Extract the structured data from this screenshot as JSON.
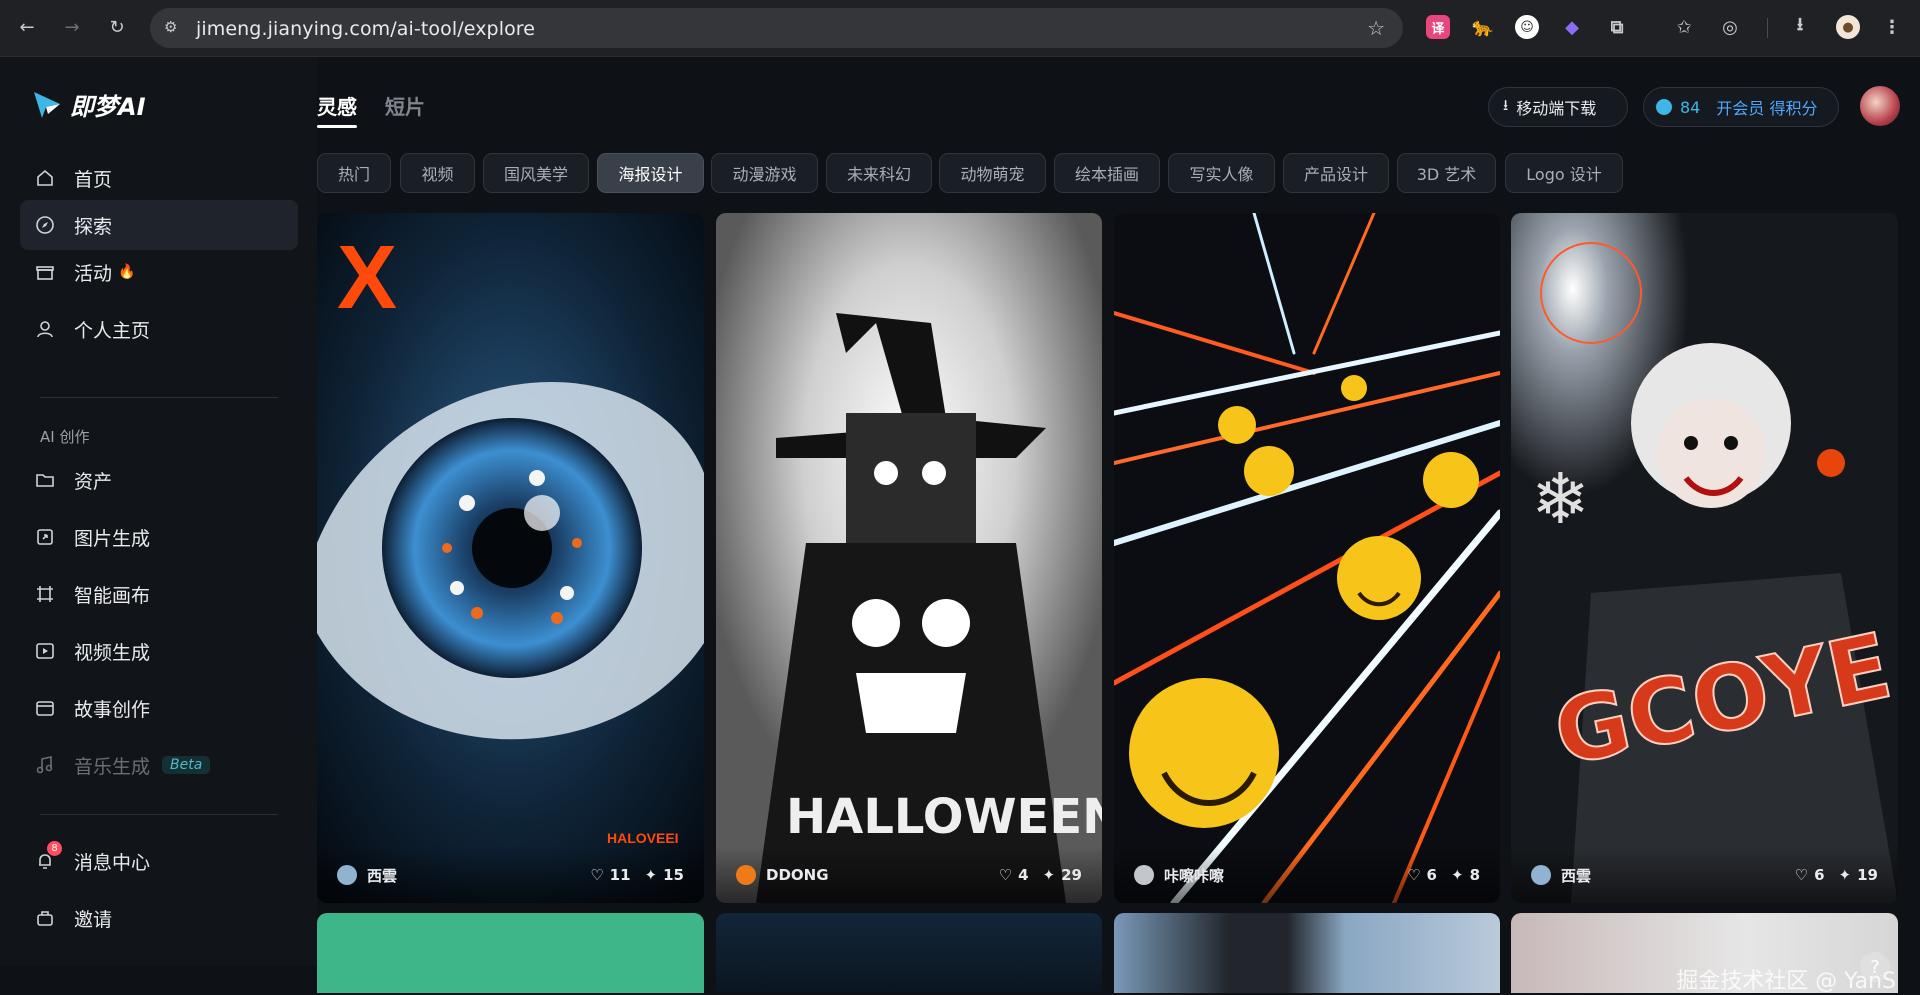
{
  "browser": {
    "url": "jimeng.jianying.com/ai-tool/explore"
  },
  "sidebar": {
    "logo_text": "即梦AI",
    "items_top": [
      {
        "label": "首页",
        "icon": "home-icon"
      },
      {
        "label": "探索",
        "icon": "compass-icon",
        "active": true
      },
      {
        "label": "活动",
        "icon": "gift-icon",
        "flame": "🔥"
      },
      {
        "label": "个人主页",
        "icon": "user-icon"
      }
    ],
    "section_label": "AI 创作",
    "items_create": [
      {
        "label": "资产",
        "icon": "folder-icon"
      },
      {
        "label": "图片生成",
        "icon": "image-gen-icon"
      },
      {
        "label": "智能画布",
        "icon": "canvas-icon"
      },
      {
        "label": "视频生成",
        "icon": "video-gen-icon"
      },
      {
        "label": "故事创作",
        "icon": "story-icon"
      },
      {
        "label": "音乐生成",
        "icon": "music-icon",
        "badge": "Beta"
      }
    ],
    "items_bottom": [
      {
        "label": "消息中心",
        "icon": "bell-icon",
        "count": "8"
      },
      {
        "label": "邀请",
        "icon": "invite-icon"
      }
    ]
  },
  "header": {
    "tabs": [
      "灵感",
      "短片"
    ],
    "download_label": "移动端下载",
    "points": "84",
    "member_label": "开会员 得积分"
  },
  "categories": [
    "热门",
    "视频",
    "国风美学",
    "海报设计",
    "动漫游戏",
    "未来科幻",
    "动物萌宠",
    "绘本插画",
    "写实人像",
    "产品设计",
    "3D 艺术",
    "Logo 设计"
  ],
  "active_category": "海报设计",
  "cards": [
    {
      "author": "西雲",
      "likes": "11",
      "remixes": "15"
    },
    {
      "author": "DDONG",
      "likes": "4",
      "remixes": "29"
    },
    {
      "author": "咔嚓咔嚓",
      "likes": "6",
      "remixes": "8"
    },
    {
      "author": "西雲",
      "likes": "6",
      "remixes": "19"
    }
  ],
  "watermark": "掘金技术社区 @ YanS",
  "colors": {
    "accent_blue": "#3fb7e6",
    "member_blue": "#4fa8ff"
  }
}
